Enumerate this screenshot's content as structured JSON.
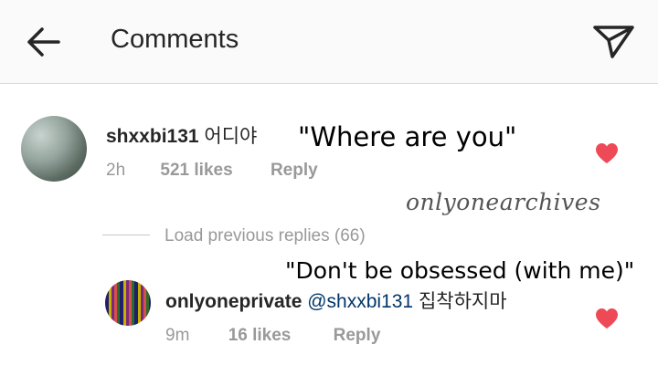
{
  "header": {
    "title": "Comments"
  },
  "comments": [
    {
      "username": "shxxbi131",
      "text": "어디야",
      "time": "2h",
      "likes": "521 likes",
      "reply": "Reply",
      "overlay": "\"Where are you\""
    }
  ],
  "load_previous": "Load previous replies (66)",
  "replies": [
    {
      "username": "onlyoneprivate",
      "mention": "@shxxbi131",
      "text": "집착하지마",
      "time": "9m",
      "likes": "16 likes",
      "reply": "Reply",
      "overlay": "\"Don't be obsessed (with me)\""
    }
  ],
  "watermark": "onlyonearchives",
  "colors": {
    "heart": "#ed4956",
    "meta": "#999999",
    "mention": "#003569"
  },
  "icons": {
    "back": "arrow-left-icon",
    "send": "paper-plane-icon",
    "like": "heart-icon"
  }
}
